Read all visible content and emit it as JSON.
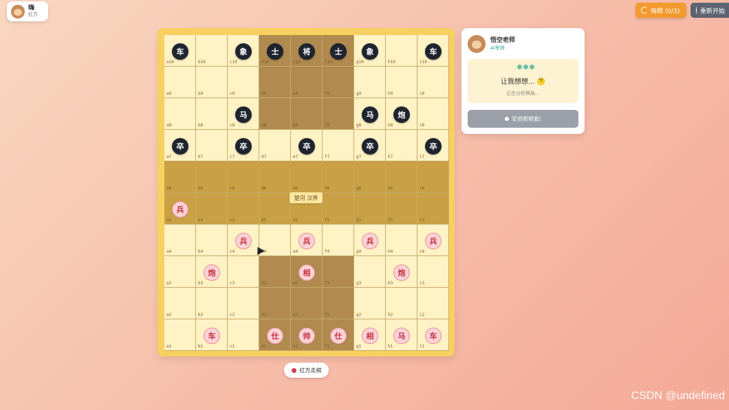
{
  "player": {
    "name": "嗨",
    "side": "红方"
  },
  "toolbar": {
    "undo_label": "悔棋 (0/3)",
    "restart_label": "重新开始"
  },
  "board": {
    "river_text": "楚河 汉界",
    "files": [
      "a",
      "b",
      "c",
      "d",
      "e",
      "f",
      "g",
      "h",
      "i"
    ],
    "pieces": [
      {
        "sq": "a10",
        "label": "车",
        "color": "black"
      },
      {
        "sq": "c10",
        "label": "象",
        "color": "black"
      },
      {
        "sq": "d10",
        "label": "士",
        "color": "black"
      },
      {
        "sq": "e10",
        "label": "将",
        "color": "black"
      },
      {
        "sq": "f10",
        "label": "士",
        "color": "black"
      },
      {
        "sq": "g10",
        "label": "象",
        "color": "black"
      },
      {
        "sq": "i10",
        "label": "车",
        "color": "black"
      },
      {
        "sq": "c8",
        "label": "马",
        "color": "black"
      },
      {
        "sq": "g8",
        "label": "马",
        "color": "black"
      },
      {
        "sq": "h8",
        "label": "炮",
        "color": "black"
      },
      {
        "sq": "a7",
        "label": "卒",
        "color": "black"
      },
      {
        "sq": "c7",
        "label": "卒",
        "color": "black"
      },
      {
        "sq": "e7",
        "label": "卒",
        "color": "black"
      },
      {
        "sq": "g7",
        "label": "卒",
        "color": "black"
      },
      {
        "sq": "i7",
        "label": "卒",
        "color": "black"
      },
      {
        "sq": "a5",
        "label": "兵",
        "color": "red"
      },
      {
        "sq": "c4",
        "label": "兵",
        "color": "red"
      },
      {
        "sq": "e4",
        "label": "兵",
        "color": "red"
      },
      {
        "sq": "g4",
        "label": "兵",
        "color": "red"
      },
      {
        "sq": "i4",
        "label": "兵",
        "color": "red"
      },
      {
        "sq": "b3",
        "label": "炮",
        "color": "red"
      },
      {
        "sq": "e3",
        "label": "相",
        "color": "red"
      },
      {
        "sq": "h3",
        "label": "炮",
        "color": "red"
      },
      {
        "sq": "b1",
        "label": "车",
        "color": "red"
      },
      {
        "sq": "d1",
        "label": "仕",
        "color": "red"
      },
      {
        "sq": "e1",
        "label": "帅",
        "color": "red"
      },
      {
        "sq": "f1",
        "label": "仕",
        "color": "red"
      },
      {
        "sq": "g1",
        "label": "相",
        "color": "red"
      },
      {
        "sq": "h1",
        "label": "马",
        "color": "red"
      },
      {
        "sq": "i1",
        "label": "车",
        "color": "red"
      }
    ]
  },
  "ai_panel": {
    "name": "悟空老师",
    "role": "AI军师",
    "thinking_title": "让我想想... 🤔",
    "thinking_sub": "正在分析棋局...",
    "help_button": "军师帮帮我!"
  },
  "status": {
    "turn_text": "红方走棋"
  },
  "watermark": "CSDN @undefined",
  "colors": {
    "black_piece": "#1e2430",
    "red_piece_text": "#c23040",
    "board_frame": "#f7d060"
  }
}
